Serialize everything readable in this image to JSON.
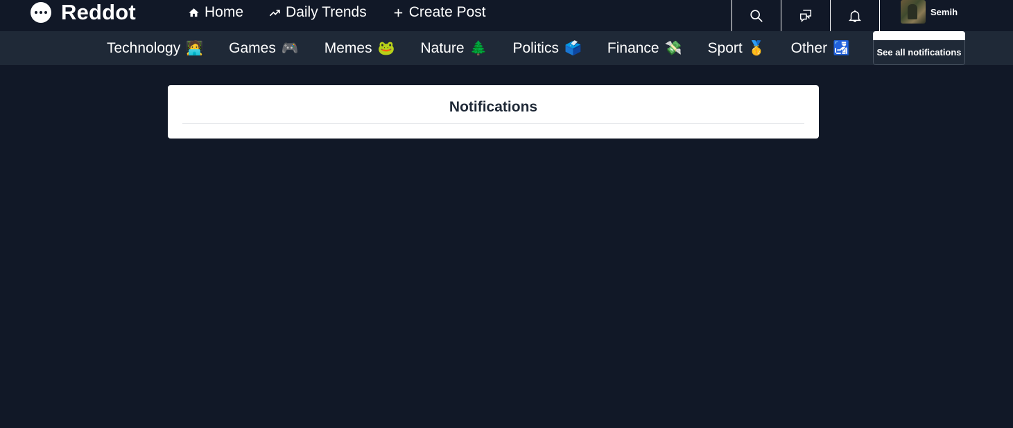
{
  "app": {
    "name": "Reddot"
  },
  "nav": {
    "items": [
      {
        "label": "Home",
        "icon": "home-icon"
      },
      {
        "label": "Daily Trends",
        "icon": "trend-icon"
      },
      {
        "label": "Create Post",
        "icon": "plus-icon"
      }
    ]
  },
  "actions": {
    "search_icon": "search-icon",
    "chat_icon": "chat-icon",
    "bell_icon": "bell-icon"
  },
  "user": {
    "name": "Semih"
  },
  "categories": [
    {
      "label": "Technology",
      "emoji": "🧑‍💻"
    },
    {
      "label": "Games",
      "emoji": "🎮"
    },
    {
      "label": "Memes",
      "emoji": "🐸"
    },
    {
      "label": "Nature",
      "emoji": "🌲"
    },
    {
      "label": "Politics",
      "emoji": "🗳️"
    },
    {
      "label": "Finance",
      "emoji": "💸"
    },
    {
      "label": "Sport",
      "emoji": "🥇"
    },
    {
      "label": "Other",
      "emoji": "🛃"
    }
  ],
  "notifications_dropdown": {
    "see_all": "See all notifications"
  },
  "page": {
    "title": "Notifications"
  },
  "colors": {
    "background": "#111827",
    "category_bar": "#1f2937",
    "card": "#ffffff",
    "card_text": "#1f2937"
  }
}
